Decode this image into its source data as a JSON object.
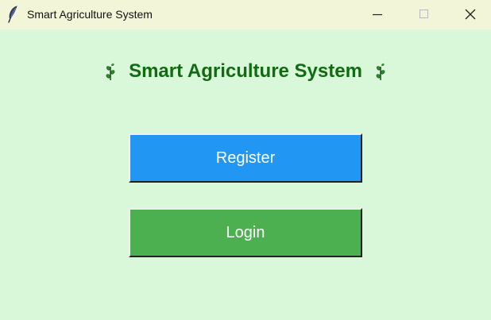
{
  "window": {
    "title": "Smart Agriculture System"
  },
  "controls": {
    "minimize": "minimize-icon",
    "maximize": "maximize-icon",
    "close": "close-icon"
  },
  "main": {
    "heading": "Smart Agriculture System",
    "heading_icon": "herb-icon",
    "heading_color": "#116b11",
    "register_label": "Register",
    "register_color": "#2196f3",
    "login_label": "Login",
    "login_color": "#4caf50"
  },
  "background_color": "#d9f7d9"
}
